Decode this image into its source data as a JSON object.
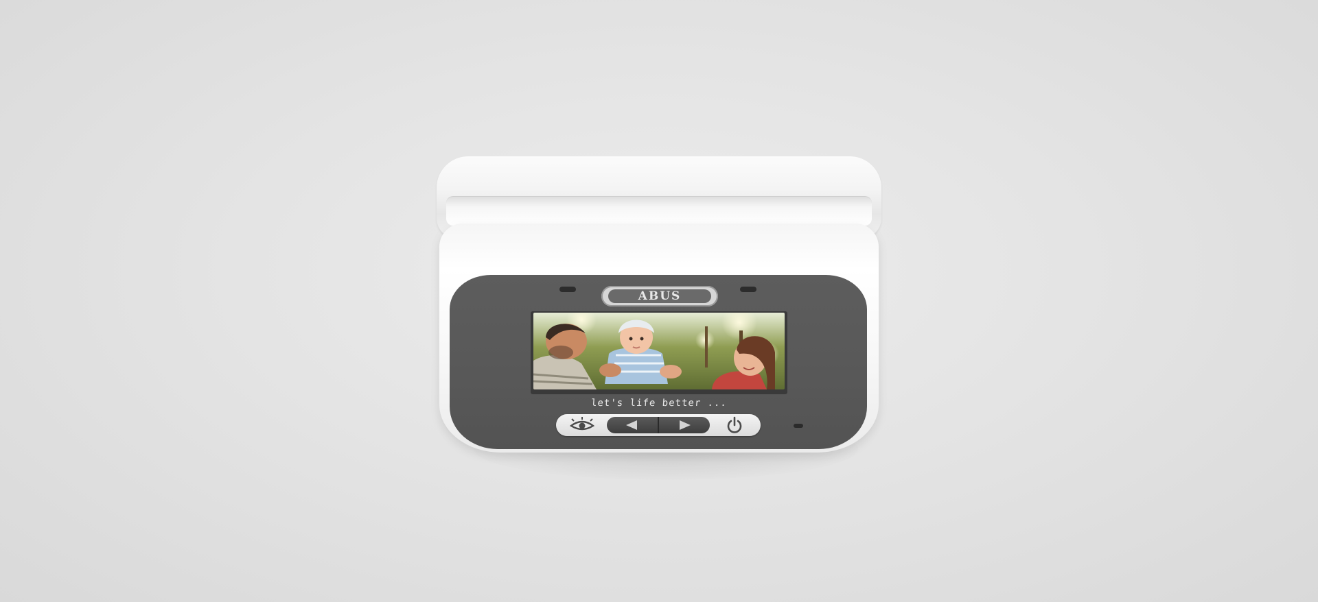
{
  "device": {
    "brand_logo": "ABUS",
    "tagline": "let's life better ...",
    "screen_image": "family-photo",
    "colors": {
      "housing": "#f7f7f7",
      "faceplate": "#585858",
      "logo_badge": "#6a6a6a",
      "button_pill": "#e6e6e6",
      "nav_pill": "#454545"
    },
    "buttons": [
      {
        "icon": "eye-icon"
      },
      {
        "icon": "arrow-left-icon"
      },
      {
        "icon": "arrow-right-icon"
      },
      {
        "icon": "power-icon"
      }
    ]
  }
}
